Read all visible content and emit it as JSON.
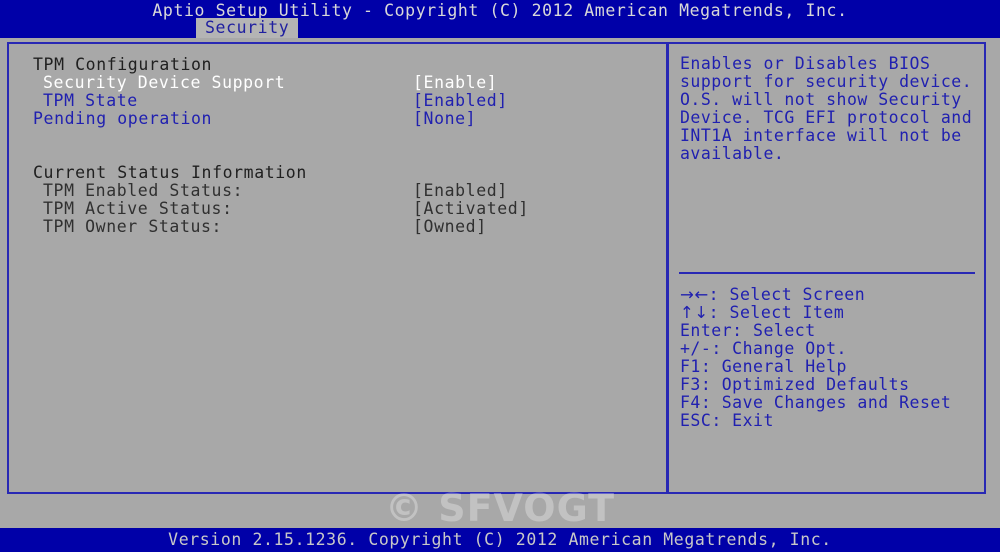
{
  "header": {
    "title": "Aptio Setup Utility - Copyright (C) 2012 American Megatrends, Inc.",
    "tabs": [
      {
        "label": "Security",
        "active": true
      }
    ]
  },
  "left_pane": {
    "sections": [
      {
        "heading": "TPM Configuration",
        "items": [
          {
            "label": "Security Device Support",
            "value": "[Enable]",
            "state": "selected",
            "indent": 1
          },
          {
            "label": "TPM State",
            "value": "[Enabled]",
            "state": "normal",
            "indent": 1
          },
          {
            "label": "Pending operation",
            "value": "[None]",
            "state": "normal",
            "indent": 0
          }
        ]
      },
      {
        "heading": "Current Status Information",
        "items": [
          {
            "label": "TPM Enabled Status:",
            "value": "[Enabled]",
            "state": "info",
            "indent": 1
          },
          {
            "label": "TPM Active Status:",
            "value": "[Activated]",
            "state": "info",
            "indent": 1
          },
          {
            "label": "TPM Owner Status:",
            "value": "[Owned]",
            "state": "info",
            "indent": 1
          }
        ]
      }
    ]
  },
  "right_pane": {
    "help_text": "Enables or Disables BIOS support for security device. O.S. will not show Security Device. TCG EFI protocol and INT1A interface will not be available.",
    "key_legend": [
      {
        "keys": "→←",
        "glyph": true,
        "desc": ": Select Screen"
      },
      {
        "keys": "↑↓",
        "glyph": true,
        "desc": ": Select Item"
      },
      {
        "keys": "Enter",
        "glyph": false,
        "desc": ": Select"
      },
      {
        "keys": "+/-",
        "glyph": false,
        "desc": ": Change Opt."
      },
      {
        "keys": "F1",
        "glyph": false,
        "desc": ": General Help"
      },
      {
        "keys": "F3",
        "glyph": false,
        "desc": ": Optimized Defaults"
      },
      {
        "keys": "F4",
        "glyph": false,
        "desc": ": Save Changes and Reset"
      },
      {
        "keys": "ESC",
        "glyph": false,
        "desc": ": Exit"
      }
    ]
  },
  "watermark": {
    "text": "© SFVOGT"
  },
  "footer": {
    "text": "Version 2.15.1236. Copyright (C) 2012 American Megatrends, Inc."
  },
  "colors": {
    "header_bg": "#0000a8",
    "body_bg": "#a8a8a8",
    "border": "#2828b4",
    "item_text": "#2020b0",
    "selected_text": "#ffffff",
    "heading_text": "#202020",
    "tab_bg": "#b4b4b4"
  }
}
